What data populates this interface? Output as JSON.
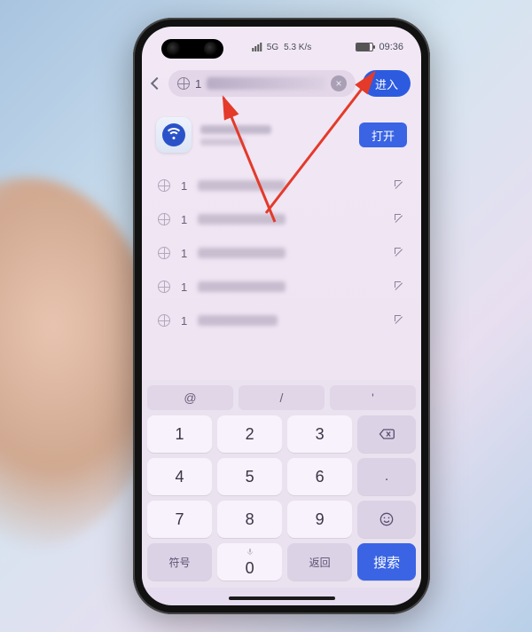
{
  "status": {
    "signal_label": "5G",
    "speed": "5.3 K/s",
    "battery_icon": "battery",
    "time": "09:36"
  },
  "address_bar": {
    "back_name": "back",
    "globe_name": "globe",
    "input_value": "1",
    "clear_label": "×",
    "enter_label": "进入"
  },
  "app_suggestion": {
    "icon_name": "wifi-app",
    "open_label": "打开"
  },
  "history": {
    "items": [
      {
        "prefix": "1"
      },
      {
        "prefix": "1"
      },
      {
        "prefix": "1"
      },
      {
        "prefix": "1"
      },
      {
        "prefix": "1"
      }
    ]
  },
  "keyboard": {
    "top_row": {
      "at": "@",
      "slash": "/",
      "apostrophe": "'"
    },
    "digits": {
      "d1": "1",
      "d2": "2",
      "d3": "3",
      "d4": "4",
      "d5": "5",
      "d6": "6",
      "d7": "7",
      "d8": "8",
      "d9": "9",
      "d0": "0"
    },
    "symbols_label": "符号",
    "return_label": "返回",
    "search_label": "搜索",
    "dot": ".",
    "backspace_name": "backspace",
    "emoji_name": "emoji",
    "mic_name": "microphone"
  },
  "annotation": {
    "color": "#e43a2a"
  }
}
